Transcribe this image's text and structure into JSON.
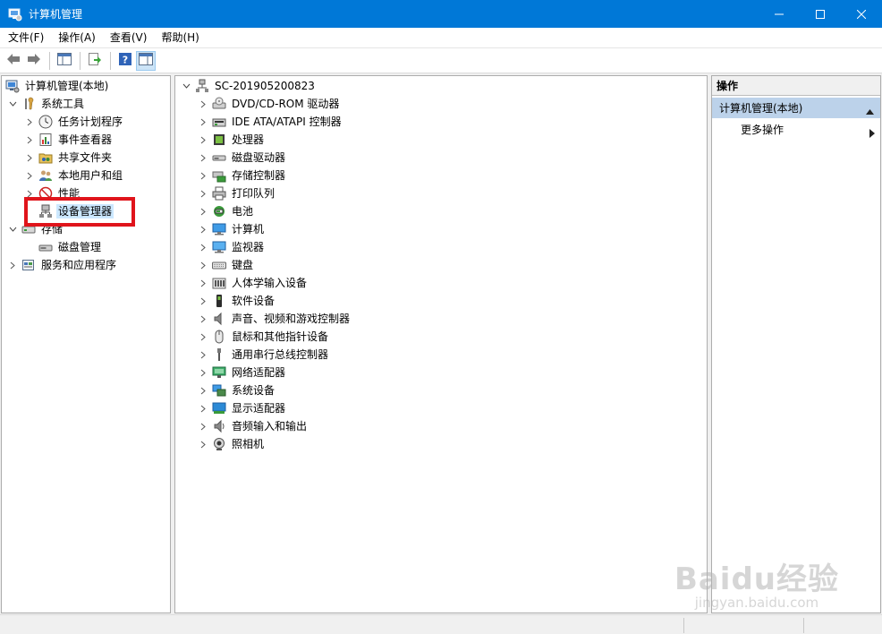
{
  "window": {
    "title": "计算机管理"
  },
  "menu": [
    "文件(F)",
    "操作(A)",
    "查看(V)",
    "帮助(H)"
  ],
  "left_tree": [
    {
      "label": "计算机管理(本地)",
      "icon": "computer-management-icon",
      "level": 0,
      "expander": "none"
    },
    {
      "label": "系统工具",
      "icon": "tools-icon",
      "level": 1,
      "expander": "expanded"
    },
    {
      "label": "任务计划程序",
      "icon": "clock-icon",
      "level": 2,
      "expander": "collapsed"
    },
    {
      "label": "事件查看器",
      "icon": "event-viewer-icon",
      "level": 2,
      "expander": "collapsed"
    },
    {
      "label": "共享文件夹",
      "icon": "shared-folder-icon",
      "level": 2,
      "expander": "collapsed"
    },
    {
      "label": "本地用户和组",
      "icon": "users-icon",
      "level": 2,
      "expander": "collapsed"
    },
    {
      "label": "性能",
      "icon": "performance-icon",
      "level": 2,
      "expander": "collapsed"
    },
    {
      "label": "设备管理器",
      "icon": "device-manager-icon",
      "level": 2,
      "expander": "none",
      "selected": true
    },
    {
      "label": "存储",
      "icon": "storage-icon",
      "level": 1,
      "expander": "expanded"
    },
    {
      "label": "磁盘管理",
      "icon": "disk-management-icon",
      "level": 2,
      "expander": "none"
    },
    {
      "label": "服务和应用程序",
      "icon": "services-icon",
      "level": 1,
      "expander": "collapsed"
    }
  ],
  "device_tree": {
    "root": "SC-201905200823",
    "categories": [
      {
        "label": "DVD/CD-ROM 驱动器",
        "icon": "dvd-drive-icon"
      },
      {
        "label": "IDE ATA/ATAPI 控制器",
        "icon": "ide-controller-icon"
      },
      {
        "label": "处理器",
        "icon": "processor-icon"
      },
      {
        "label": "磁盘驱动器",
        "icon": "disk-drive-icon"
      },
      {
        "label": "存储控制器",
        "icon": "storage-controller-icon"
      },
      {
        "label": "打印队列",
        "icon": "printer-icon"
      },
      {
        "label": "电池",
        "icon": "battery-icon"
      },
      {
        "label": "计算机",
        "icon": "computer-icon"
      },
      {
        "label": "监视器",
        "icon": "monitor-icon"
      },
      {
        "label": "键盘",
        "icon": "keyboard-icon"
      },
      {
        "label": "人体学输入设备",
        "icon": "hid-icon"
      },
      {
        "label": "软件设备",
        "icon": "software-device-icon"
      },
      {
        "label": "声音、视频和游戏控制器",
        "icon": "speaker-icon"
      },
      {
        "label": "鼠标和其他指针设备",
        "icon": "mouse-icon"
      },
      {
        "label": "通用串行总线控制器",
        "icon": "usb-icon"
      },
      {
        "label": "网络适配器",
        "icon": "network-adapter-icon"
      },
      {
        "label": "系统设备",
        "icon": "system-device-icon"
      },
      {
        "label": "显示适配器",
        "icon": "display-adapter-icon"
      },
      {
        "label": "音频输入和输出",
        "icon": "audio-io-icon"
      },
      {
        "label": "照相机",
        "icon": "camera-icon"
      }
    ]
  },
  "actions": {
    "header": "操作",
    "group": "计算机管理(本地)",
    "item": "更多操作"
  },
  "watermark": {
    "main": "Baidu经验",
    "sub": "jingyan.baidu.com"
  },
  "colors": {
    "titlebar": "#0078d7",
    "highlight": "#e0141b",
    "actions_group": "#bcd2ea",
    "selection": "#cce8ff"
  }
}
